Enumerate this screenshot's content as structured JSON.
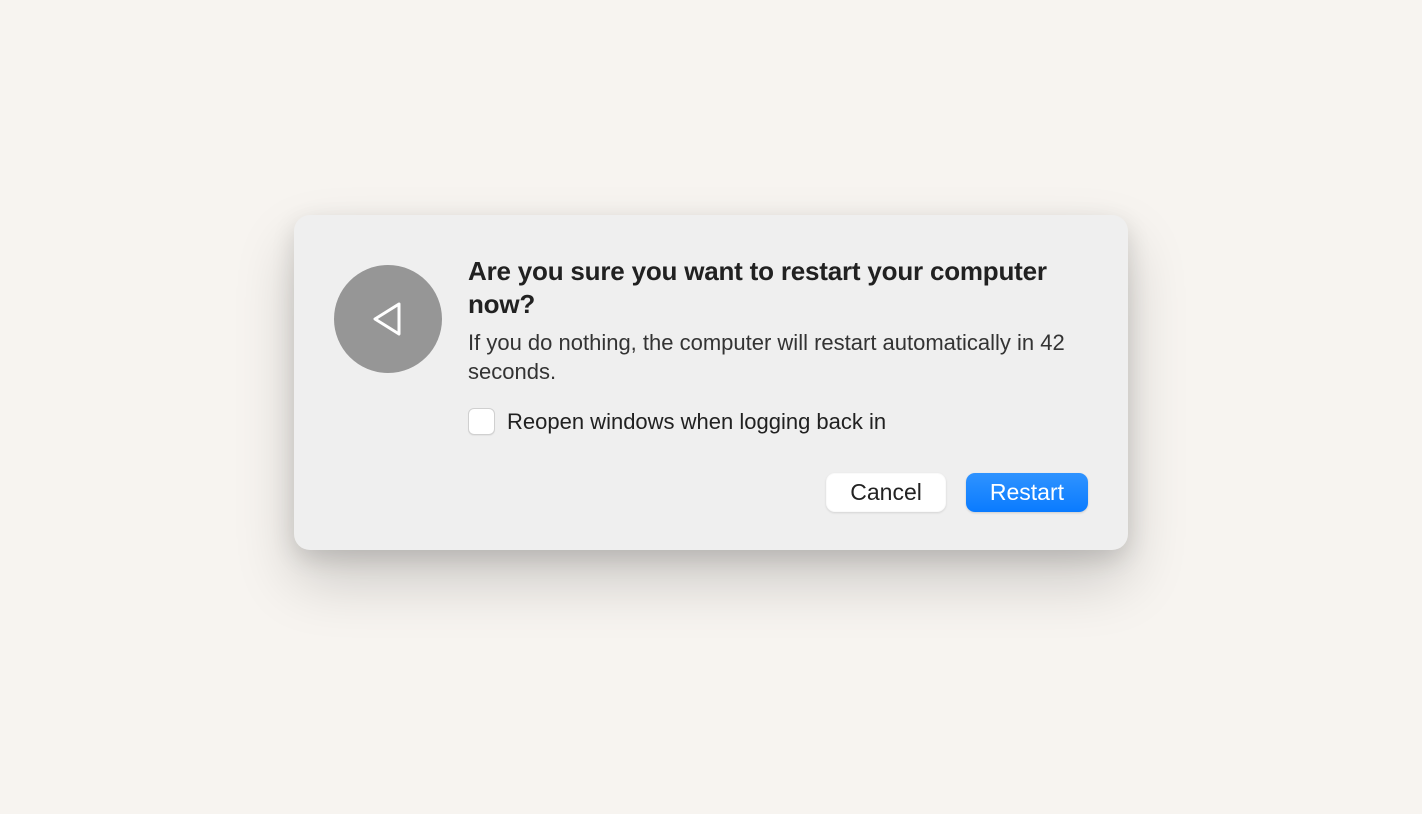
{
  "dialog": {
    "title": "Are you sure you want to restart your computer now?",
    "body": "If you do nothing, the computer will restart automatically in 42 seconds.",
    "checkbox_label": "Reopen windows when logging back in",
    "checkbox_checked": false,
    "buttons": {
      "cancel": "Cancel",
      "confirm": "Restart"
    },
    "countdown_seconds": 42
  },
  "colors": {
    "background": "#f7f4f0",
    "dialog_bg": "#efefef",
    "icon_circle": "#969696",
    "primary_button": "#0a7bff"
  }
}
